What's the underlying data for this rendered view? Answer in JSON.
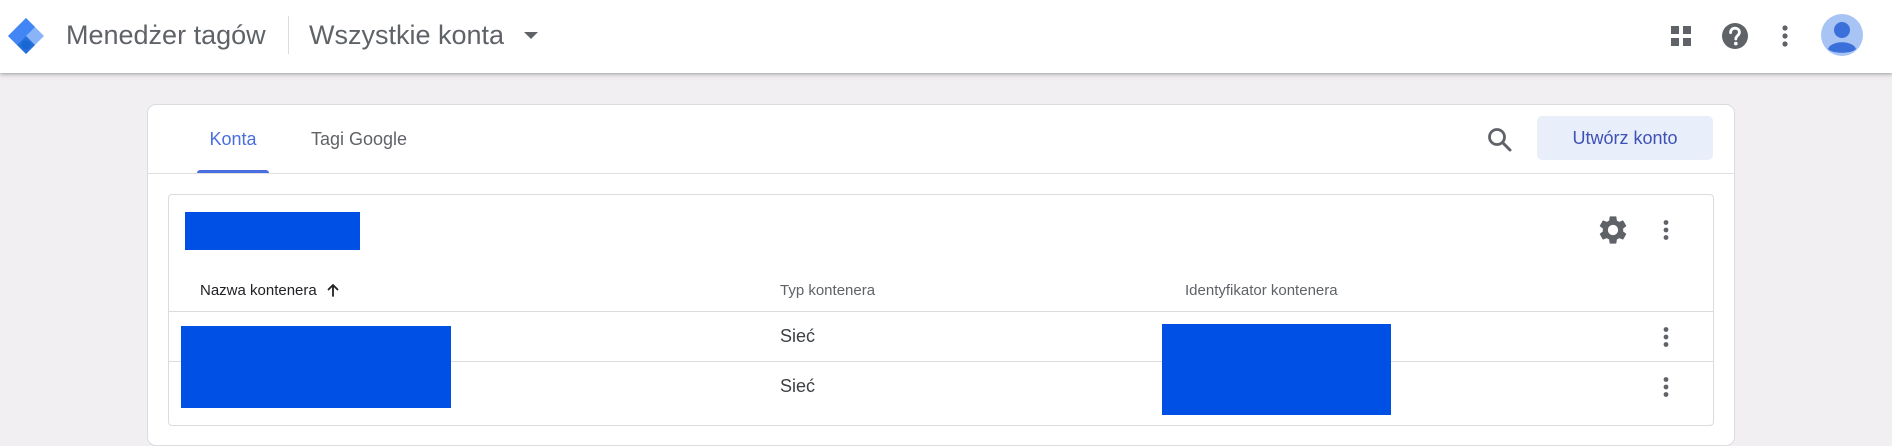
{
  "header": {
    "app_title": "Menedżer tagów",
    "account_picker": "Wszystkie konta",
    "icons": [
      "apps-icon",
      "help-icon",
      "more-vert-icon",
      "account-avatar-icon"
    ]
  },
  "tabs": [
    {
      "label": "Konta",
      "active": true
    },
    {
      "label": "Tagi Google",
      "active": false
    }
  ],
  "actions": {
    "create_account": "Utwórz konto"
  },
  "table": {
    "columns": [
      "Nazwa kontenera",
      "Typ kontenera",
      "Identyfikator kontenera"
    ],
    "sort": {
      "column": "Nazwa kontenera",
      "direction": "ascending"
    },
    "rows": [
      {
        "type": "Sieć"
      },
      {
        "type": "Sieć"
      }
    ]
  },
  "colors": {
    "accent": "#4a6ee0",
    "button_bg": "#e8eefa",
    "button_text": "#3f51b5",
    "redaction": "#0050e6",
    "page_bg": "#f1eff1"
  }
}
